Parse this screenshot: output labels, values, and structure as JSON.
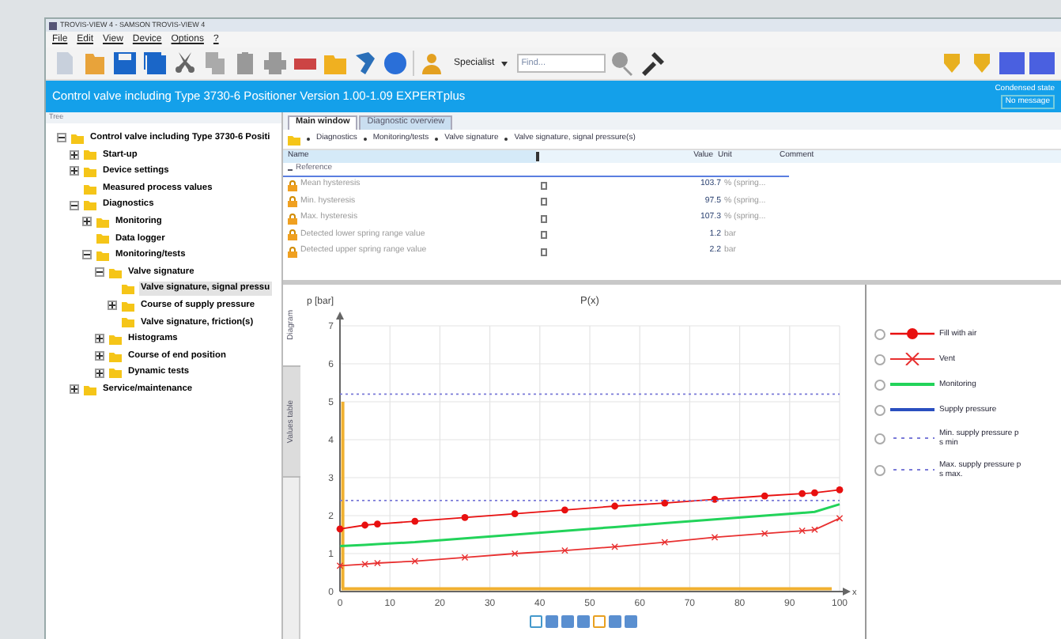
{
  "window": {
    "title": "TROVIS-VIEW 4 - SAMSON TROVIS-VIEW 4"
  },
  "menu": [
    "File",
    "Edit",
    "View",
    "Device",
    "Options",
    "?"
  ],
  "toolbar": {
    "user_level": "Specialist",
    "search": {
      "placeholder": "Find..."
    }
  },
  "header": {
    "title": "Control valve including Type 3730-6 Positioner  Version 1.00-1.09 EXPERTplus",
    "state_label": "Condensed state",
    "state_value": "No message"
  },
  "tree": {
    "title": "Tree",
    "items": [
      {
        "label": "Control valve including Type 3730-6 Positi",
        "expanded": true,
        "selected": false,
        "children": [
          {
            "label": "Start-up",
            "expanded": false,
            "selected": false
          },
          {
            "label": "Device settings",
            "expanded": false,
            "selected": false
          },
          {
            "label": "Measured process values",
            "selected": false
          },
          {
            "label": "Diagnostics",
            "expanded": true,
            "selected": false,
            "children": [
              {
                "label": "Monitoring",
                "expanded": false,
                "selected": false
              },
              {
                "label": "Data logger",
                "selected": false
              },
              {
                "label": "Monitoring/tests",
                "expanded": true,
                "selected": false,
                "children": [
                  {
                    "label": "Valve signature",
                    "expanded": true,
                    "selected": false,
                    "children": [
                      {
                        "label": "Valve signature, signal pressu",
                        "selected": true
                      },
                      {
                        "label": "Course of supply pressure",
                        "expanded": false,
                        "selected": false
                      },
                      {
                        "label": "Valve signature, friction(s)",
                        "selected": false
                      }
                    ]
                  },
                  {
                    "label": "Histograms",
                    "expanded": false,
                    "selected": false
                  },
                  {
                    "label": "Course of end position",
                    "expanded": false,
                    "selected": false
                  },
                  {
                    "label": "Dynamic tests",
                    "expanded": false,
                    "selected": false
                  }
                ]
              }
            ]
          },
          {
            "label": "Service/maintenance",
            "expanded": false,
            "selected": false
          }
        ]
      }
    ]
  },
  "tabs": [
    {
      "label": "Main window",
      "selected": true
    },
    {
      "label": "Diagnostic overview",
      "selected": false
    }
  ],
  "breadcrumb": [
    "Diagnostics",
    "Monitoring/tests",
    "Valve signature",
    "Valve signature, signal pressure(s)"
  ],
  "table": {
    "columns": [
      "Name",
      "Value",
      "Unit",
      "Comment"
    ],
    "group": "Reference",
    "rows": [
      {
        "name": "Mean hysteresis",
        "value": "103.7",
        "unit": "% (spring..."
      },
      {
        "name": "Min. hysteresis",
        "value": "97.5",
        "unit": "% (spring..."
      },
      {
        "name": "Max. hysteresis",
        "value": "107.3",
        "unit": "% (spring..."
      },
      {
        "name": "Detected lower spring range value",
        "value": "1.2",
        "unit": "bar"
      },
      {
        "name": "Detected upper spring range value",
        "value": "2.2",
        "unit": "bar"
      }
    ]
  },
  "side_tabs": [
    {
      "label": "Diagram",
      "selected": true
    },
    {
      "label": "Values table",
      "selected": false
    }
  ],
  "chart": {
    "chart_data": {
      "type": "line",
      "grid": true,
      "title": "P(x)",
      "ylabel": "p  [bar]",
      "xlabel": "x",
      "x": [
        0,
        5,
        7.5,
        15,
        25,
        35,
        45,
        55,
        65,
        75,
        85,
        92.5,
        95,
        100
      ],
      "xlim": [
        0,
        100
      ],
      "ylim": [
        0,
        7
      ],
      "xticks": [
        0,
        10,
        20,
        30,
        40,
        50,
        60,
        70,
        80,
        90,
        100
      ],
      "yticks": [
        0,
        1,
        2,
        3,
        4,
        5,
        6,
        7
      ],
      "series": [
        {
          "name": "Fill with air",
          "color": "#e81010",
          "marker": "circle",
          "values": [
            1.65,
            1.75,
            1.78,
            1.85,
            1.95,
            2.05,
            2.15,
            2.25,
            2.33,
            2.43,
            2.52,
            2.58,
            2.6,
            2.68
          ]
        },
        {
          "name": "Vent",
          "color": "#e83030",
          "marker": "x",
          "values": [
            0.68,
            0.72,
            0.75,
            0.8,
            0.9,
            1.0,
            1.08,
            1.18,
            1.3,
            1.43,
            1.53,
            1.6,
            1.63,
            1.93
          ]
        },
        {
          "name": "Monitoring",
          "color": "#22d35a",
          "values": [
            1.2,
            1.23,
            1.25,
            1.3,
            1.4,
            1.5,
            1.6,
            1.7,
            1.8,
            1.9,
            2.0,
            2.07,
            2.1,
            2.3
          ]
        },
        {
          "name": "Supply pressure",
          "color": "#2a4fc0",
          "values": [
            null,
            null,
            null,
            null,
            null,
            null,
            null,
            null,
            null,
            null,
            null,
            null,
            null,
            null
          ]
        },
        {
          "name": "Min. supply pressure p s min",
          "color": "#7a7ad8",
          "line_style": "dashed",
          "values": [
            2.4,
            2.4,
            2.4,
            2.4,
            2.4,
            2.4,
            2.4,
            2.4,
            2.4,
            2.4,
            2.4,
            2.4,
            2.4,
            2.4
          ]
        },
        {
          "name": "Max. supply pressure p s max.",
          "color": "#7a7ad8",
          "line_style": "dashed",
          "values": [
            5.2,
            5.2,
            5.2,
            5.2,
            5.2,
            5.2,
            5.2,
            5.2,
            5.2,
            5.2,
            5.2,
            5.2,
            5.2,
            5.2
          ]
        }
      ]
    }
  }
}
